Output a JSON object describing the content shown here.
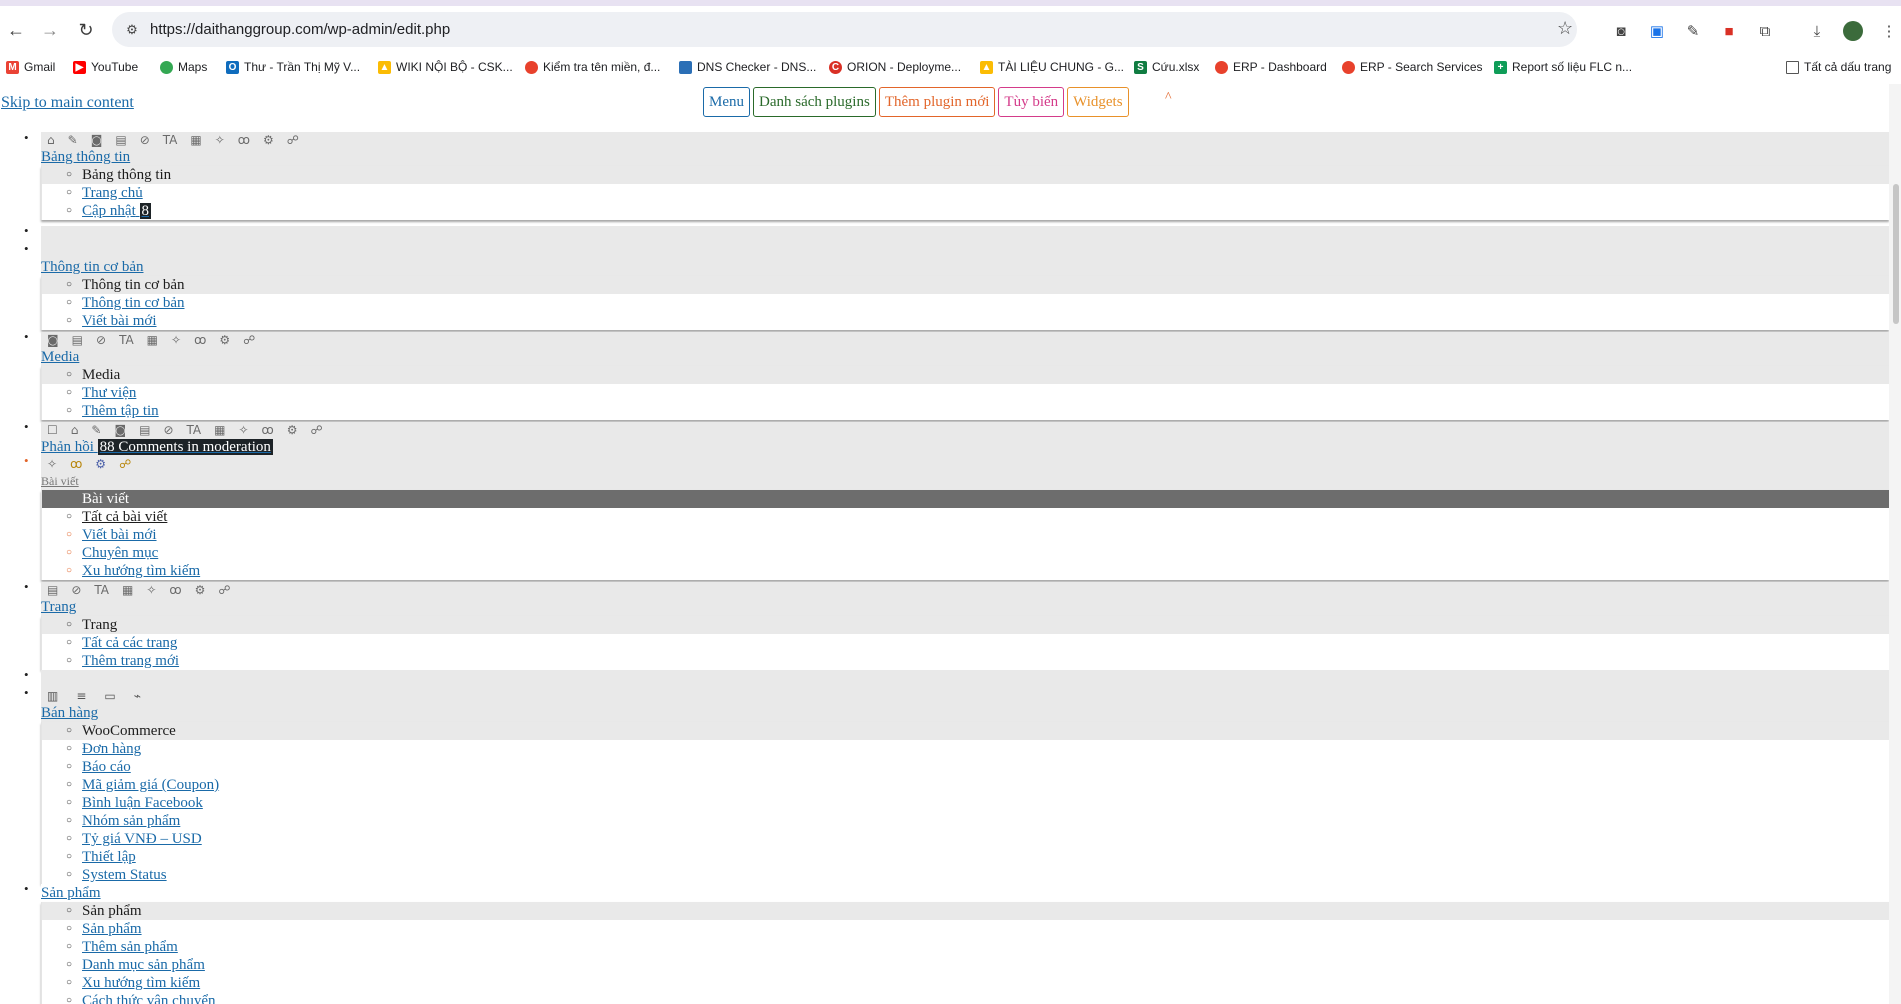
{
  "browser": {
    "url": "https://daithanggroup.com/wp-admin/edit.php",
    "bookmarks": [
      {
        "label": "Gmail",
        "color": "#ea4335"
      },
      {
        "label": "YouTube",
        "color": "#ff0000"
      },
      {
        "label": "Maps",
        "color": "#34a853"
      },
      {
        "label": "Thư - Trần Thị Mỹ V...",
        "color": "#0f6cbd"
      },
      {
        "label": "WIKI NỘI BỘ - CSK...",
        "color": "#fbbc04"
      },
      {
        "label": "Kiểm tra tên miền, đ...",
        "color": "#e8412c"
      },
      {
        "label": "DNS Checker - DNS...",
        "color": "#2b6fb6"
      },
      {
        "label": "ORION - Deployme...",
        "color": "#d93025"
      },
      {
        "label": "TÀI LIỆU CHUNG - G...",
        "color": "#fbbc04"
      },
      {
        "label": "Cứu.xlsx",
        "color": "#107c41"
      },
      {
        "label": "ERP - Dashboard",
        "color": "#e8412c"
      },
      {
        "label": "ERP - Search Services",
        "color": "#e8412c"
      },
      {
        "label": "Report số liệu FLC n...",
        "color": "#0f9d58"
      }
    ],
    "all_bookmarks": "Tất cả dấu trang"
  },
  "page": {
    "skip_link": "Skip to main content",
    "top_buttons": [
      "Menu",
      "Danh sách plugins",
      "Thêm plugin mới",
      "Tùy biến",
      "Widgets"
    ],
    "caret": "^"
  },
  "menu": {
    "dashboard": {
      "label": "Bảng thông tin",
      "sub": [
        "Bảng thông tin",
        "Trang chủ",
        "Cập nhật"
      ],
      "update_count": "8"
    },
    "basic": {
      "label": "Thông tin cơ bản",
      "sub": [
        "Thông tin cơ bản",
        "Thông tin cơ bản",
        "Viết bài mới"
      ]
    },
    "media": {
      "label": "Media",
      "sub": [
        "Media",
        "Thư viện",
        "Thêm tập tin"
      ]
    },
    "comments": {
      "label": "Phản hồi",
      "badge": "88 Comments in moderation"
    },
    "posts": {
      "label": "Bài viết",
      "sub": [
        "Bài viết",
        "Tất cả bài viết",
        "Viết bài mới",
        "Chuyên mục",
        "Xu hướng tìm kiếm"
      ]
    },
    "pages": {
      "label": "Trang",
      "sub": [
        "Trang",
        "Tất cả các trang",
        "Thêm trang mới"
      ]
    },
    "sales": {
      "label": "Bán hàng",
      "sub": [
        "WooCommerce",
        "Đơn hàng",
        "Báo cáo",
        "Mã giảm giá (Coupon)",
        "Bình luận Facebook",
        "Nhóm sản phẩm",
        "Tỷ giá VNĐ – USD",
        "Thiết lập",
        "System Status"
      ]
    },
    "products": {
      "label": "Sản phẩm",
      "sub": [
        "Sản phẩm",
        "Sản phẩm",
        "Thêm sản phẩm",
        "Danh mục sản phẩm",
        "Xu hướng tìm kiếm",
        "Cách thức vận chuyển"
      ]
    }
  }
}
